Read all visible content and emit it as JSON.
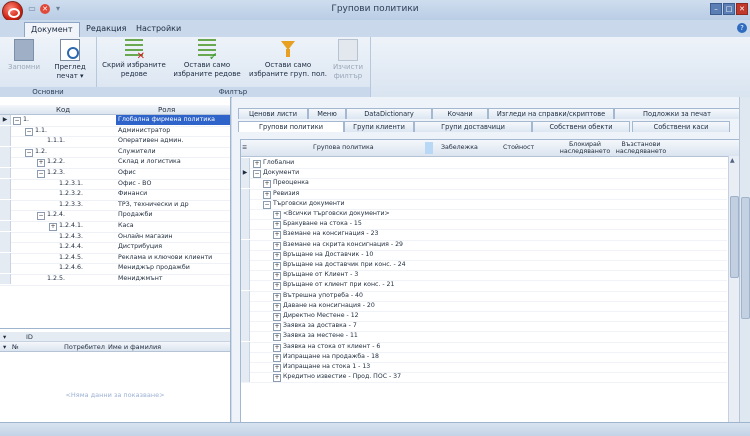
{
  "window": {
    "title": "Групови политики"
  },
  "ribbon_tabs": [
    "Документ",
    "Редакция",
    "Настройки"
  ],
  "ribbon": {
    "groups": [
      {
        "label": "Основни"
      },
      {
        "label": "Филтър"
      }
    ],
    "buttons": [
      {
        "label1": "Запомни",
        "label2": ""
      },
      {
        "label1": "Преглед",
        "label2": "печат ▾"
      },
      {
        "label1": "Скрий избраните",
        "label2": "редове"
      },
      {
        "label1": "Остави само",
        "label2": "избраните редове"
      },
      {
        "label1": "Остави само",
        "label2": "избраните груп. пол."
      },
      {
        "label1": "Изчисти",
        "label2": "филтър"
      }
    ]
  },
  "left_tree": {
    "headers": {
      "code": "Код",
      "role": "Роля"
    },
    "rows": [
      {
        "code": "1.",
        "role": "Глобална фирмена политика",
        "pm": "−"
      },
      {
        "code": "1.1.",
        "role": "Администратор",
        "pm": "−"
      },
      {
        "code": "1.1.1.",
        "role": "Оперативен админ.",
        "pm": ""
      },
      {
        "code": "1.2.",
        "role": "Служители",
        "pm": "−"
      },
      {
        "code": "1.2.2.",
        "role": "Склад и логистика",
        "pm": "+"
      },
      {
        "code": "1.2.3.",
        "role": "Офис",
        "pm": "−"
      },
      {
        "code": "1.2.3.1.",
        "role": "Офис - ВО",
        "pm": ""
      },
      {
        "code": "1.2.3.2.",
        "role": "Финанси",
        "pm": ""
      },
      {
        "code": "1.2.3.3.",
        "role": "ТРЗ, технически и др",
        "pm": ""
      },
      {
        "code": "1.2.4.",
        "role": "Продажби",
        "pm": "−"
      },
      {
        "code": "1.2.4.1.",
        "role": "Каса",
        "pm": "+"
      },
      {
        "code": "1.2.4.3.",
        "role": "Онлайн магазин",
        "pm": ""
      },
      {
        "code": "1.2.4.4.",
        "role": "Дистрибуция",
        "pm": ""
      },
      {
        "code": "1.2.4.5.",
        "role": "Реклама и ключови клиенти",
        "pm": ""
      },
      {
        "code": "1.2.4.6.",
        "role": "Мениджър продажби",
        "pm": ""
      },
      {
        "code": "1.2.5.",
        "role": "Мениджмънт",
        "pm": ""
      }
    ]
  },
  "users_grid": {
    "id_header": "ID",
    "headers": {
      "no": "№",
      "user": "Потребител",
      "name": "Име и фамилия"
    },
    "empty_text": "<Няма данни за показване>"
  },
  "right_tabs_row1": [
    "Ценови листи",
    "Меню",
    "DataDictionary",
    "Кочани",
    "Изгледи на справки/скриптове",
    "Подложки за печат"
  ],
  "right_tabs_row2": [
    "Групови политики",
    "Групи клиенти",
    "Групи доставчици",
    "Собствени обекти",
    "Собствени каси"
  ],
  "policy_grid": {
    "headers": {
      "policy": "Групова политика",
      "note": "Забележка",
      "value": "Стойност",
      "block1": "Блокирай",
      "block2": "наследяването",
      "restore1": "Възстанови",
      "restore2": "наследяването"
    },
    "rows": [
      {
        "text": "Глобални",
        "pm": "+",
        "level": 0
      },
      {
        "text": "Документи",
        "pm": "−",
        "level": 0
      },
      {
        "text": "Преоценка",
        "pm": "+",
        "level": 1
      },
      {
        "text": "Ревизия",
        "pm": "+",
        "level": 1
      },
      {
        "text": "Търговски документи",
        "pm": "−",
        "level": 1
      },
      {
        "text": "<Всички търговски документи>",
        "pm": "+",
        "level": 2
      },
      {
        "text": "Бракуване на стока - 15",
        "pm": "+",
        "level": 2
      },
      {
        "text": "Вземане на консигнация - 23",
        "pm": "+",
        "level": 2
      },
      {
        "text": "Вземане на скрита консигнация - 29",
        "pm": "+",
        "level": 2
      },
      {
        "text": "Връщане на Доставчик - 10",
        "pm": "+",
        "level": 2
      },
      {
        "text": "Връщане на доставчик при конс. - 24",
        "pm": "+",
        "level": 2
      },
      {
        "text": "Връщане от Клиент - 3",
        "pm": "+",
        "level": 2
      },
      {
        "text": "Връщане от клиент при конс. - 21",
        "pm": "+",
        "level": 2
      },
      {
        "text": "Вътрешна употреба - 40",
        "pm": "+",
        "level": 2
      },
      {
        "text": "Даване на консигнация - 20",
        "pm": "+",
        "level": 2
      },
      {
        "text": "Директно Местене - 12",
        "pm": "+",
        "level": 2
      },
      {
        "text": "Заявка за доставка - 7",
        "pm": "+",
        "level": 2
      },
      {
        "text": "Заявка за местене - 11",
        "pm": "+",
        "level": 2
      },
      {
        "text": "Заявка на стока от клиент - 6",
        "pm": "+",
        "level": 2
      },
      {
        "text": "Изпращане на продажба - 18",
        "pm": "+",
        "level": 2
      },
      {
        "text": "Изпращане на стока 1 - 13",
        "pm": "+",
        "level": 2
      },
      {
        "text": "Кредитно известие - Прод.  ПОС - 37",
        "pm": "+",
        "level": 2
      }
    ]
  }
}
